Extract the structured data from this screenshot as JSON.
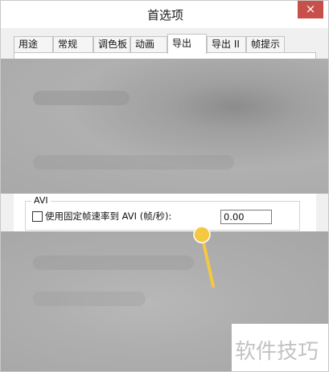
{
  "window": {
    "title": "首选项",
    "close_glyph": "×"
  },
  "tabs": [
    {
      "label": "用途",
      "active": false
    },
    {
      "label": "常规",
      "active": false
    },
    {
      "label": "调色板",
      "active": false
    },
    {
      "label": "动画",
      "active": false
    },
    {
      "label": "导出",
      "active": true
    },
    {
      "label": "导出 II",
      "active": false
    },
    {
      "label": "帧提示",
      "active": false
    }
  ],
  "avi": {
    "group_label": "AVI",
    "checkbox_label": "使用固定帧速率到 AVI (帧/秒):",
    "checkbox_checked": false,
    "fps_value": "0.00"
  },
  "annotation": {
    "pointer_color": "#f5c842"
  },
  "watermark": {
    "text": "软件技巧"
  },
  "colors": {
    "close_button": "#c7504a"
  }
}
